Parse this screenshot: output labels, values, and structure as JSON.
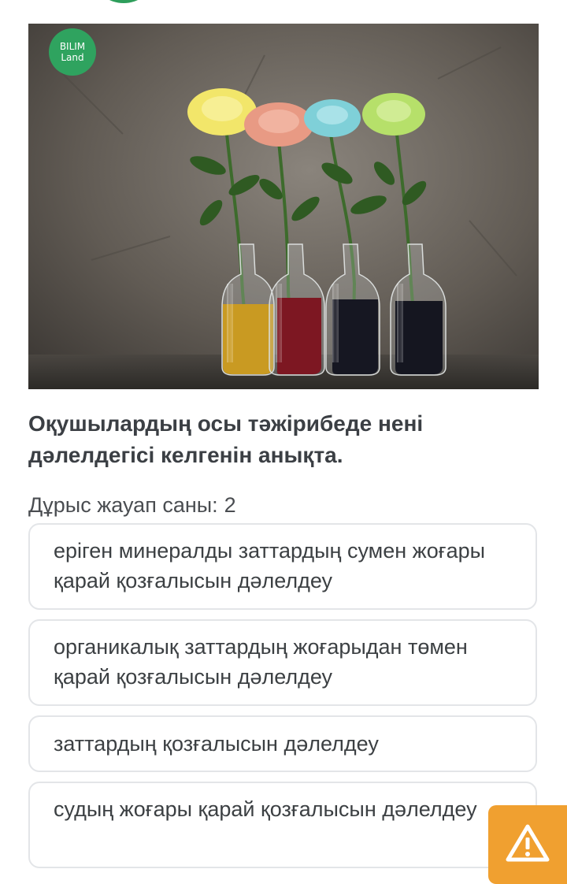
{
  "logo": {
    "line1": "BILIM",
    "line2": "Land"
  },
  "question": {
    "text": "Оқушылардың осы тәжірибеде нені дәлелдегісі келгенін анықта."
  },
  "answer_count": {
    "label": "Дұрыс жауап саны:",
    "value": "2"
  },
  "options": [
    {
      "text": "еріген минералды заттардың сумен жоғары қарай қозғалысын дәлелдеу"
    },
    {
      "text": "органикалық заттардың жоғарыдан төмен қарай қозғалысын дәлелдеу"
    },
    {
      "text": "заттардың қозғалысын дәлелдеу"
    },
    {
      "text": "судың жоғары қарай қозғалысын дәлелдеу"
    }
  ],
  "colors": {
    "brand_green": "#2fa35f",
    "warning_orange": "#f0a030",
    "option_border": "#e3e5e8"
  },
  "icons": {
    "warning": "warning-triangle-icon"
  }
}
